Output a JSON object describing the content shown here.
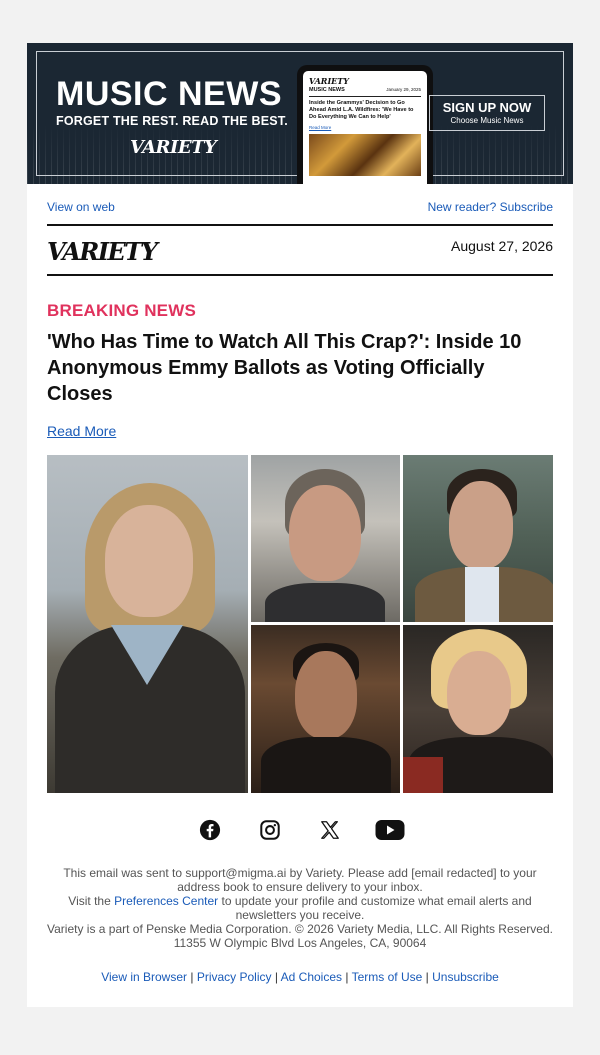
{
  "banner": {
    "title": "MUSIC NEWS",
    "tagline": "FORGET THE REST. READ THE BEST.",
    "logo_text": "VARIETY",
    "phone": {
      "logo": "VARIETY",
      "section": "MUSIC NEWS",
      "date": "January 29, 2025",
      "headline": "Inside the Grammys' Decision to Go Ahead Amid L.A. Wildfires: 'We Have to Do Everything We Can to Help'",
      "link": "Read More"
    },
    "signup_label": "SIGN UP NOW",
    "signup_sub": "Choose Music News"
  },
  "toplinks": {
    "view_web": "View on web",
    "subscribe": "New reader? Subscribe"
  },
  "masthead": {
    "logo": "VARIETY",
    "date": "August 27, 2026"
  },
  "article": {
    "kicker": "BREAKING NEWS",
    "headline": "'Who Has Time to Watch All This Crap?': Inside 10 Anonymous Emmy Ballots as Voting Officially Closes",
    "read_more": "Read More"
  },
  "social": [
    "facebook-icon",
    "instagram-icon",
    "x-icon",
    "youtube-icon"
  ],
  "footer": {
    "line1": "This email was sent to support@migma.ai by Variety. Please add [email redacted] to your address book to ensure delivery to your inbox.",
    "visit_prefix": "Visit the ",
    "preferences_link": "Preferences Center",
    "visit_suffix": " to update your profile and customize what email alerts and newsletters you receive.",
    "line3": "Variety is a part of Penske Media Corporation. © 2026 Variety Media, LLC. All Rights Reserved.",
    "address": "11355 W Olympic Blvd Los Angeles, CA, 90064"
  },
  "legal_links": {
    "view_browser": "View in Browser",
    "privacy": "Privacy Policy",
    "ad_choices": "Ad Choices",
    "terms": "Terms of Use",
    "unsubscribe": "Unsubscribe",
    "separator": "|"
  }
}
